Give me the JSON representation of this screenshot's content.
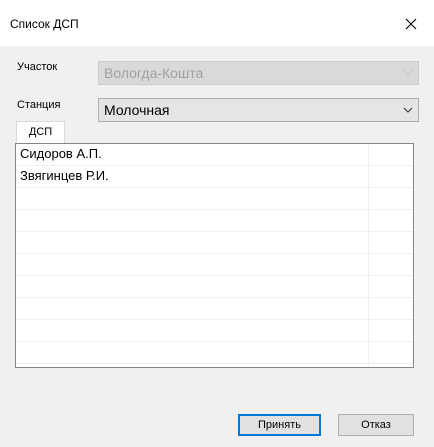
{
  "window": {
    "title": "Список ДСП"
  },
  "form": {
    "section_label": "Участок",
    "section_value": "Вологда-Кошта",
    "station_label": "Станция",
    "station_value": "Молочная"
  },
  "tab": {
    "label": "ДСП"
  },
  "list": {
    "rows": [
      "Сидоров А.П.",
      "Звягинцев Р.И.",
      "",
      "",
      "",
      "",
      "",
      "",
      "",
      ""
    ]
  },
  "buttons": {
    "ok": "Принять",
    "cancel": "Отказ"
  },
  "colors": {
    "accent": "#0078d7",
    "background": "#f0f0f0",
    "disabled_text": "#a0a0a0"
  },
  "icons": {
    "close": "close-icon",
    "dropdown": "chevron-down-icon"
  }
}
